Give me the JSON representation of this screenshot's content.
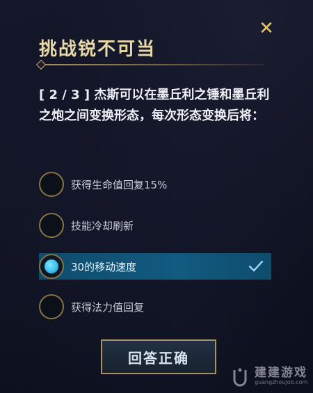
{
  "dialog": {
    "title": "挑战锐不可当",
    "question": "[ 2 / 3 ] 杰斯可以在墨丘利之锤和墨丘利之炮之间变换形态，每次形态变换后将：",
    "options": [
      {
        "label": "获得生命值回复15%",
        "selected": false
      },
      {
        "label": "技能冷却刷新",
        "selected": false
      },
      {
        "label": "30的移动速度",
        "selected": true
      },
      {
        "label": "获得法力值回复",
        "selected": false
      }
    ],
    "answer_button": "回答正确"
  },
  "watermark": {
    "text": "建建游戏",
    "domain": "guangzhoujob.com"
  },
  "colors": {
    "title": "#e8d9a8",
    "accent_gold": "#e8c66c",
    "selected_bg": "#125a80",
    "radio_fill": "#2bb6e8"
  },
  "icons": {
    "close": "close-icon",
    "check": "check-icon"
  }
}
